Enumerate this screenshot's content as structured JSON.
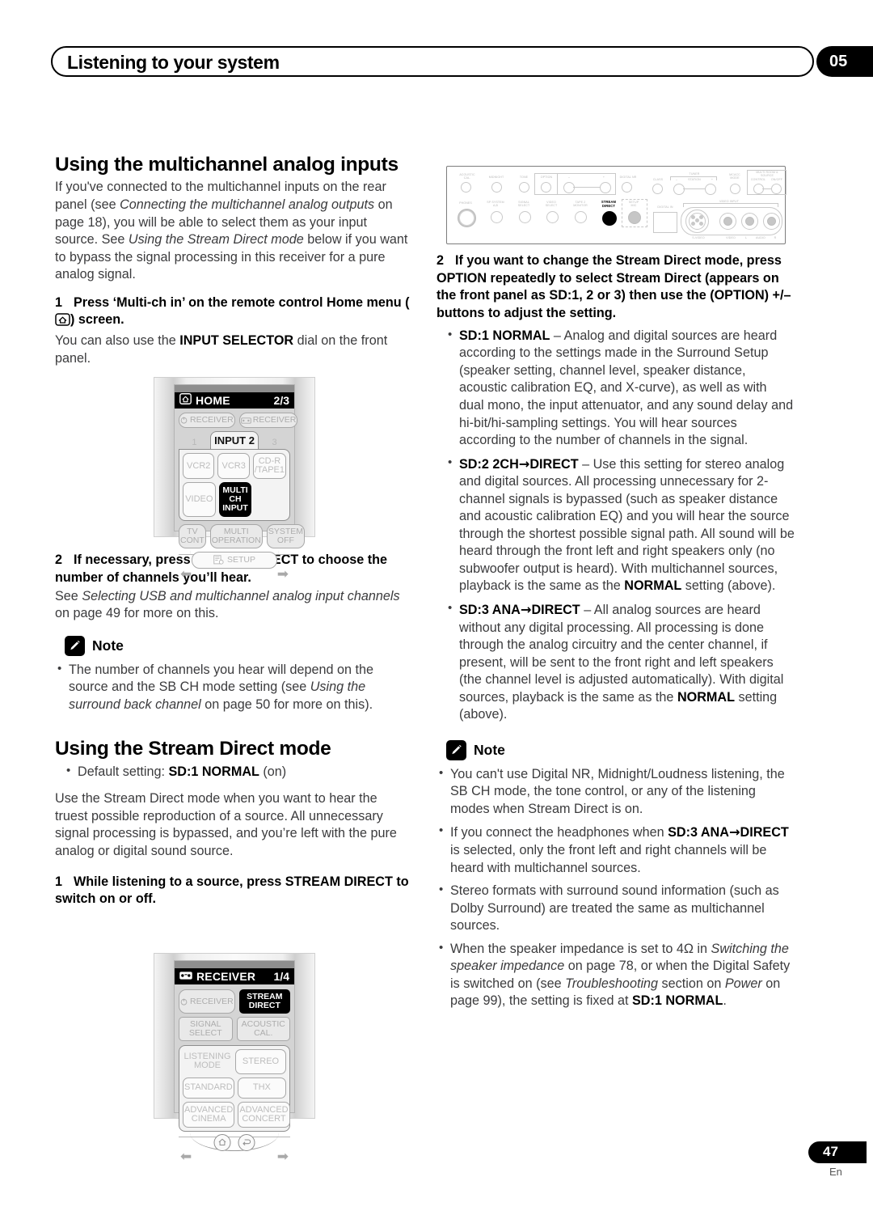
{
  "header": {
    "title": "Listening to your system",
    "chapter_number": "05"
  },
  "footer": {
    "page_number": "47",
    "language": "En"
  },
  "left_column": {
    "heading1": "Using the multichannel analog inputs",
    "intro_p1_a": "If you've connected to the multichannel inputs on the rear panel (see ",
    "intro_p1_i1": "Connecting the multichannel analog outputs",
    "intro_p1_b": " on page 18), you will be able to select them as your input source. See ",
    "intro_p1_i2": "Using the Stream Direct mode",
    "intro_p1_c": " below if you want to bypass the signal processing in this receiver for a pure analog signal.",
    "step1_num": "1",
    "step1_a": "Press ‘Multi-ch in’ on the remote control Home menu (",
    "step1_b": ") screen.",
    "step1_sub_a": "You can also use the ",
    "step1_sub_b": "INPUT SELECTOR",
    "step1_sub_c": " dial on the front panel.",
    "step2_num": "2",
    "step2_text": "If necessary, press SIGNAL SELECT to choose the number of channels you’ll hear.",
    "step2_sub_a": "See ",
    "step2_sub_i": "Selecting USB and multichannel analog input channels",
    "step2_sub_b": " on page 49 for more on this.",
    "note_label": "Note",
    "note_item_a": "The number of channels you hear will depend on the source and the SB CH mode setting (see ",
    "note_item_i": "Using the surround back channel",
    "note_item_b": " on page 50 for more on this).",
    "heading2": "Using the Stream Direct mode",
    "default_a": "Default setting: ",
    "default_b": "SD:1 NORMAL",
    "default_c": " (on)",
    "sd_intro": "Use the Stream Direct mode when you want to hear the truest possible reproduction of a source. All unnecessary signal processing is bypassed, and you’re left with the pure analog or digital sound source.",
    "sd_step1_num": "1",
    "sd_step1_text": "While listening to a source, press STREAM DIRECT to switch on or off."
  },
  "right_column": {
    "step2_num": "2",
    "step2_text": "If you want to change the Stream Direct mode, press OPTION repeatedly to select Stream Direct (appears on the front panel as SD:1, 2 or 3) then use the (OPTION) +/– buttons to adjust the setting.",
    "sd1_label": "SD:1 NORMAL",
    "sd1_text": " – Analog and digital sources are heard according to the settings made in the Surround Setup (speaker setting, channel level, speaker distance, acoustic calibration EQ, and X-curve), as well as with dual mono, the input attenuator, and any sound delay and hi-bit/hi-sampling settings. You will hear sources according to the number of channels in the signal.",
    "sd2_label_a": "SD:2 2CH",
    "sd2_arrow": "→",
    "sd2_label_b": "DIRECT",
    "sd2_text_a": " – Use this setting for stereo analog and digital sources. All processing unnecessary for 2-channel signals is bypassed (such as speaker distance and acoustic calibration EQ) and you will hear the source through the shortest possible signal path. All sound will be heard through the front left and right speakers only (no subwoofer output is heard). With multichannel sources, playback is the same as the ",
    "sd2_bold": "NORMAL",
    "sd2_text_b": " setting (above).",
    "sd3_label_a": "SD:3 ANA",
    "sd3_arrow": "→",
    "sd3_label_b": "DIRECT",
    "sd3_text_a": " – All analog sources are heard without any digital processing. All processing is done through the analog circuitry and the center channel, if present, will be sent to the front right and left speakers (the channel level is adjusted automatically). With digital sources, playback is the same as the ",
    "sd3_bold": "NORMAL",
    "sd3_text_b": " setting (above).",
    "note_label": "Note",
    "note1": "You can't use Digital NR, Midnight/Loudness listening, the SB CH mode, the tone control, or any of the listening modes when Stream Direct is on.",
    "note2_a": "If you connect the headphones when ",
    "note2_b": "SD:3 ANA",
    "note2_arrow": "→",
    "note2_c": "DIRECT",
    "note2_d": " is selected, only the front left and right channels will be heard with multichannel sources.",
    "note3": "Stereo formats with surround sound information (such as Dolby Surround) are treated the same as multichannel sources.",
    "note4_a": "When the speaker impedance is set to 4Ω in ",
    "note4_i1": "Switching the speaker impedance",
    "note4_b": " on page 78, or when the Digital Safety is switched on (see ",
    "note4_i2": "Troubleshooting",
    "note4_c": " section on ",
    "note4_i3": "Power",
    "note4_d": " on page 99), the setting is fixed at ",
    "note4_bold": "SD:1 NORMAL",
    "note4_e": "."
  },
  "remote_home": {
    "screen_title": "HOME",
    "page_indicator": "2/3",
    "top_buttons": [
      "RECEIVER",
      "RECEIVER"
    ],
    "tabs": [
      "1",
      "INPUT 2",
      "3"
    ],
    "panel_buttons_row1": [
      "VCR2",
      "VCR3",
      "CD-R\n/TAPE1"
    ],
    "panel_buttons_row2": [
      "VIDEO",
      "MULTI CH\nINPUT",
      ""
    ],
    "bottom_buttons": [
      "TV\nCONT",
      "MULTI\nOPERATION",
      "SYSTEM\nOFF"
    ],
    "setup_label": "SETUP",
    "selected_button": "MULTI CH INPUT"
  },
  "remote_receiver": {
    "screen_title": "RECEIVER",
    "page_indicator": "1/4",
    "row1": [
      "RECEIVER",
      "STREAM\nDIRECT"
    ],
    "row2": [
      "SIGNAL\nSELECT",
      "ACOUSTIC\nCAL."
    ],
    "row3": [
      "LISTENING\nMODE",
      "STEREO"
    ],
    "row4": [
      "STANDARD",
      "THX"
    ],
    "row5": [
      "ADVANCED\nCINEMA",
      "ADVANCED\nCONCERT"
    ],
    "selected_button": "STREAM DIRECT"
  },
  "front_panel": {
    "top_row_labels": [
      "ACOUSTIC\nCAL.",
      "MIDNIGHT",
      "TONE",
      "OPTION",
      "–",
      "+",
      "DIGITAL NR",
      "CLASS",
      "STATION",
      "MCACC\nMODE",
      "CONTROL",
      "ON/OFF"
    ],
    "tuner_group": "TUNER",
    "tuner_minus": "–",
    "tuner_plus": "+",
    "multiroom_group": "MULTI ROOM & SOURCE",
    "bottom_row_labels": [
      "PHONES",
      "SP SYSTEM\nA,B",
      "SIGNAL\nSELECT",
      "VIDEO\nSELECT",
      "TAPE 2\nMONITOR",
      "STREAM\nDIRECT",
      "SETUP\nMIC",
      "DIGITAL IN"
    ],
    "video_input_group": "VIDEO INPUT",
    "jack_labels": [
      "S-VIDEO",
      "VIDEO",
      "L",
      "AUDIO",
      "R"
    ],
    "highlighted_control": "STREAM DIRECT"
  },
  "colors": {
    "ink": "#231f20",
    "body_text": "#3b3b3d",
    "black": "#000000",
    "remote_grey": "#d4d4d4",
    "panel_light": "#f3f3f3"
  }
}
